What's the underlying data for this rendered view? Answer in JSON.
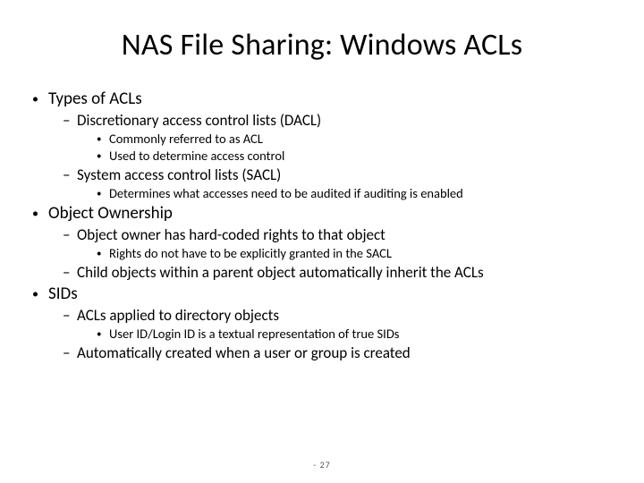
{
  "title": "NAS File Sharing: Windows ACLs",
  "page_number": "- 27",
  "content": [
    {
      "label": "Types of ACLs",
      "children": [
        {
          "label": "Discretionary access control lists (DACL)",
          "children": [
            {
              "label": "Commonly referred to as  ACL"
            },
            {
              "label": "Used to determine access control"
            }
          ]
        },
        {
          "label": "System access control lists (SACL)",
          "children": [
            {
              "label": "Determines what accesses need to be audited if auditing is enabled"
            }
          ]
        }
      ]
    },
    {
      "label": "Object Ownership",
      "children": [
        {
          "label": "Object owner has hard-coded rights to that object",
          "children": [
            {
              "label": "Rights do not have to be explicitly granted in the SACL"
            }
          ]
        },
        {
          "label": "Child objects within a parent object automatically inherit the ACLs"
        }
      ]
    },
    {
      "label": "SIDs",
      "children": [
        {
          "label": "ACLs applied to directory objects",
          "children": [
            {
              "label": "User ID/Login ID is a textual representation of true SIDs"
            }
          ]
        },
        {
          "label": "Automatically created when a user or group is created"
        }
      ]
    }
  ]
}
